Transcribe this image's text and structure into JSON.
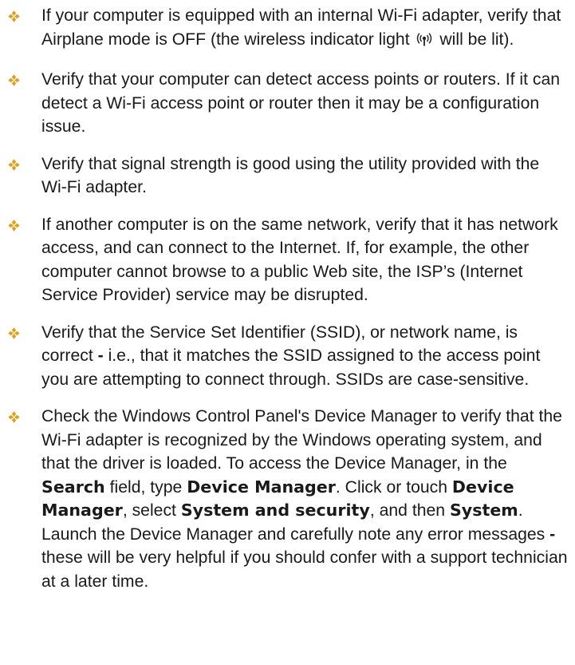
{
  "bullet_color": "#e39d18",
  "bullet_icon": "diamond-cluster-icon",
  "wifi_icon": "wireless-indicator-icon",
  "items": [
    {
      "t0": "If your computer is equipped with an internal Wi-Fi adapter, verify that Airplane mode is OFF (the wireless indicator light ",
      "t1": " will be lit)."
    },
    {
      "t0": "Verify that your computer can detect access points or routers. If it can detect a Wi-Fi access point or router then it may be a configuration issue."
    },
    {
      "t0": "Verify that signal strength is good using the utility provided with the Wi-Fi adapter."
    },
    {
      "t0": "If another computer is on the same network, verify that it has network access, and can connect to the Internet. If, for example, the other computer cannot browse to a public Web site, the ISP’s (Internet Service Provider) service may be disrupted."
    },
    {
      "t0": "Verify that the Service Set Identifier (SSID), or network name, is correct ",
      "dash": "-",
      "t1": " i.e., that it matches the SSID assigned to the access point you are attempting to connect through. SSIDs are case-sensitive."
    },
    {
      "t0": "Check the Windows Control Panel's Device Manager to verify that the Wi-Fi adapter is recognized by the Windows operating system, and that the driver is loaded. To access the Device Manager, in the ",
      "b0": "Search",
      "t1": " field, type ",
      "b1": "Device Manager",
      "t2": ". Click or touch ",
      "b2": "Device Manager",
      "t3": ", select ",
      "b3": "System and security",
      "t4": ", and then ",
      "b4": "System",
      "t5": ". Launch the Device Manager and carefully note any error messages ",
      "dash": "-",
      "t6": " these will be very helpful if you should confer with a support technician at a later time."
    }
  ]
}
